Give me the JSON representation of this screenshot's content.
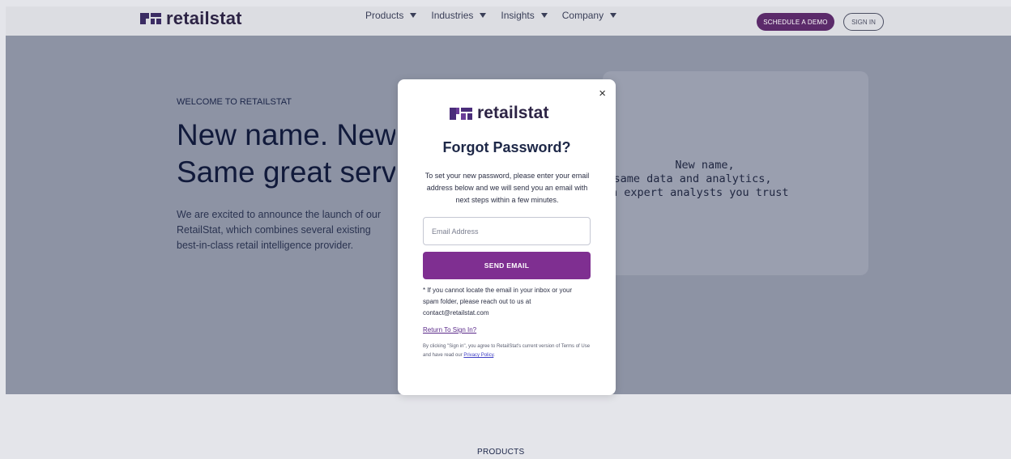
{
  "header": {
    "logo_text": "retailstat",
    "nav": [
      "Products",
      "Industries",
      "Insights",
      "Company"
    ],
    "demo_button": "SCHEDULE A DEMO",
    "signin_button": "SIGN IN"
  },
  "hero": {
    "kicker": "WELCOME TO RETAILSTAT",
    "title_line1": "New name. New",
    "title_line2": "Same great service",
    "body_line1": "We are excited to announce the launch of our",
    "body_line2": "RetailStat, which combines several existing",
    "body_line3": "best-in-class retail intelligence provider.",
    "card_line1": "New name,",
    "card_line2": "same data and analytics,",
    "card_line3": "h expert analysts you trust"
  },
  "section": {
    "products_label": "PRODUCTS"
  },
  "modal": {
    "close_icon": "×",
    "logo_text": "retailstat",
    "title": "Forgot Password?",
    "description": "To set your new password, please enter your email address below and we will send you an email with next steps within a few minutes.",
    "email_placeholder": "Email Address",
    "send_button": "SEND EMAIL",
    "note": "* If you cannot locate the email in your inbox or your spam folder, please reach out to us at contact@retailstat.com",
    "return_link": "Return To Sign In?",
    "legal_prefix": "By clicking \"Sign in\", you agree to RetailStat's current version of Terms of Use  and have read our ",
    "privacy_link": "Privacy Policy",
    "legal_suffix": "."
  },
  "colors": {
    "brand_purple": "#7f2f91",
    "demo_button": "#5b2a6a",
    "overlay_hero": "#8d93a4"
  }
}
